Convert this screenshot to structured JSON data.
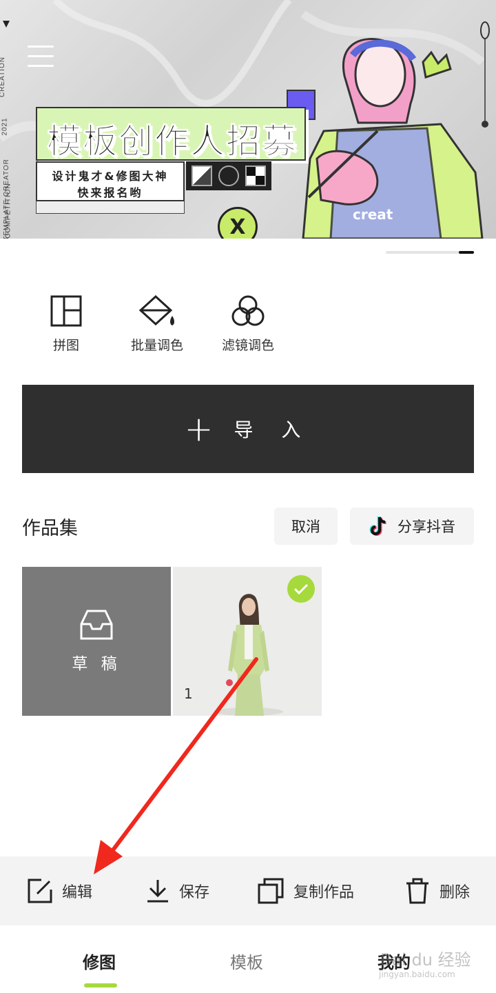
{
  "banner": {
    "title": "模板创作人招募",
    "subtitle_line1": "设计鬼才&修图大神",
    "subtitle_line2": "快来报名哟",
    "side_text_1": "CREATION",
    "side_text_2": "2021",
    "side_text_3": "TEMPLATE CREATOR",
    "side_text_4": "COMPETITION",
    "shirt_text": "creat",
    "coin_symbol": "X"
  },
  "tools": [
    {
      "label": "拼图",
      "icon": "collage-grid-icon"
    },
    {
      "label": "批量调色",
      "icon": "paint-bucket-icon"
    },
    {
      "label": "滤镜调色",
      "icon": "filter-circles-icon"
    }
  ],
  "import": {
    "label": "导 入",
    "icon": "plus-icon"
  },
  "works": {
    "title": "作品集",
    "cancel_label": "取消",
    "share_label": "分享抖音",
    "draft_label": "草 稿",
    "items": [
      {
        "number": "1",
        "selected": true
      }
    ]
  },
  "actions": [
    {
      "label": "编辑",
      "icon": "edit-icon"
    },
    {
      "label": "保存",
      "icon": "download-icon"
    },
    {
      "label": "复制作品",
      "icon": "copy-icon"
    },
    {
      "label": "删除",
      "icon": "trash-icon"
    }
  ],
  "nav": {
    "tabs": [
      {
        "label": "修图",
        "active": true
      },
      {
        "label": "模板",
        "active": false
      },
      {
        "label": "我的",
        "active": false
      }
    ]
  },
  "watermark": {
    "text": "Bai du 经验",
    "sub": "jingyan.baidu.com"
  },
  "colors": {
    "accent_green": "#a6d93c",
    "import_bg": "#2f2f2f",
    "arrow_red": "#f0281e"
  }
}
